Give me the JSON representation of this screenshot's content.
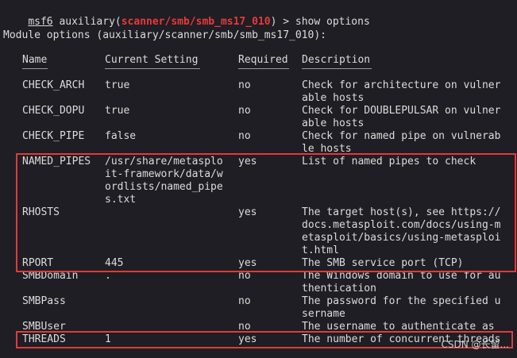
{
  "prompt": {
    "msf": "msf6",
    "pre": " auxiliary(",
    "module": "scanner/smb/smb_ms17_010",
    "post": ") > show options"
  },
  "module_options_title": "Module options (auxiliary/scanner/smb/smb_ms17_010):",
  "columns": [
    "Name",
    "Current Setting",
    "Required",
    "Description"
  ],
  "rows": [
    {
      "name": "CHECK_ARCH",
      "setting": [
        "true"
      ],
      "required": "no",
      "description": [
        "Check for architecture on vulner",
        "able hosts"
      ]
    },
    {
      "name": "CHECK_DOPU",
      "setting": [
        "true"
      ],
      "required": "no",
      "description": [
        "Check for DOUBLEPULSAR on vulner",
        "able hosts"
      ]
    },
    {
      "name": "CHECK_PIPE",
      "setting": [
        "false"
      ],
      "required": "no",
      "description": [
        "Check for named pipe on vulnerab",
        "le hosts"
      ]
    },
    {
      "name": "NAMED_PIPES",
      "setting": [
        "/usr/share/metasplo",
        "it-framework/data/w",
        "ordlists/named_pipe",
        "s.txt"
      ],
      "required": "yes",
      "description": [
        "List of named pipes to check"
      ]
    },
    {
      "name": "RHOSTS",
      "setting": [
        ""
      ],
      "required": "yes",
      "description": [
        "The target host(s), see https://",
        "docs.metasploit.com/docs/using-m",
        "etasploit/basics/using-metasploi",
        "t.html"
      ]
    },
    {
      "name": "RPORT",
      "setting": [
        "445"
      ],
      "required": "yes",
      "description": [
        "The SMB service port (TCP)"
      ]
    },
    {
      "name": "SMBDomain",
      "setting": [
        "."
      ],
      "required": "no",
      "description": [
        "The Windows domain to use for au",
        "thentication"
      ]
    },
    {
      "name": "SMBPass",
      "setting": [
        ""
      ],
      "required": "no",
      "description": [
        "The password for the specified u",
        "sername"
      ]
    },
    {
      "name": "SMBUser",
      "setting": [
        ""
      ],
      "required": "no",
      "description": [
        "The username to authenticate as"
      ]
    },
    {
      "name": "THREADS",
      "setting": [
        "1"
      ],
      "required": "yes",
      "description": [
        "The number of concurrent threads"
      ]
    }
  ],
  "watermark": "CSDN @长留...",
  "colors": {
    "background": "#1e1e24",
    "text": "#dcdcdc",
    "module": "#e83a3a",
    "highlight_box": "#e03a3a"
  }
}
